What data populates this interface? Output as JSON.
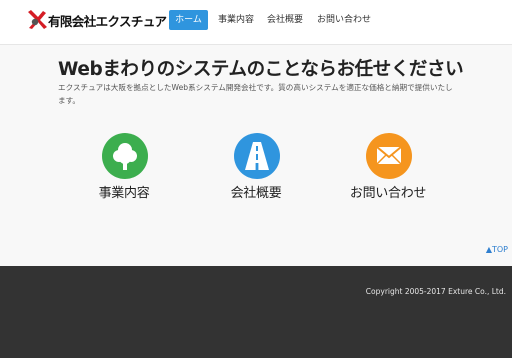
{
  "header": {
    "logo_text": "有限会社エクスチュア",
    "nav": [
      {
        "label": "ホーム",
        "active": true
      },
      {
        "label": "事業内容",
        "active": false
      },
      {
        "label": "会社概要",
        "active": false
      },
      {
        "label": "お問い合わせ",
        "active": false
      }
    ]
  },
  "hero": {
    "title": "Webまわりのシステムのことならお任せください",
    "description": "エクスチュアは大阪を拠点としたWeb系システム開発会社です。質の高いシステムを適正な価格と納期で提供いたします。"
  },
  "features": [
    {
      "label": "事業内容",
      "icon": "tree-icon",
      "color": "#3cae4e"
    },
    {
      "label": "会社概要",
      "icon": "road-icon",
      "color": "#2f95de"
    },
    {
      "label": "お問い合わせ",
      "icon": "mail-icon",
      "color": "#f5951e"
    }
  ],
  "to_top": "▲TOP",
  "footer": {
    "copyright": "Copyright 2005-2017 Exture Co., Ltd."
  },
  "colors": {
    "accent": "#2f95de",
    "footer_bg": "#333333",
    "main_bg": "#f8f8f8"
  }
}
